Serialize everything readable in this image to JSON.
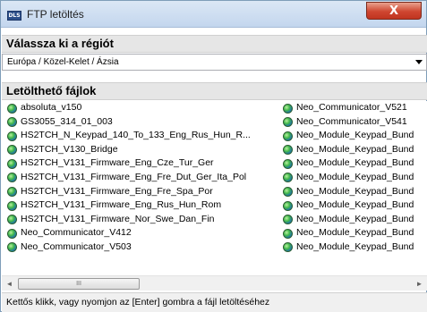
{
  "window": {
    "title": "FTP letöltés",
    "app_icon_text": "DLS",
    "close_glyph": "X"
  },
  "region": {
    "heading": "Válassza ki a régiót",
    "selected": "Európa / Közel-Kelet / Ázsia"
  },
  "files": {
    "heading": "Letölthető fájlok",
    "column1": [
      "absoluta_v150",
      "GS3055_314_01_003",
      "HS2TCH_N_Keypad_140_To_133_Eng_Rus_Hun_R...",
      "HS2TCH_V130_Bridge",
      "HS2TCH_V131_Firmware_Eng_Cze_Tur_Ger",
      "HS2TCH_V131_Firmware_Eng_Fre_Dut_Ger_Ita_Pol",
      "HS2TCH_V131_Firmware_Eng_Fre_Spa_Por",
      "HS2TCH_V131_Firmware_Eng_Rus_Hun_Rom",
      "HS2TCH_V131_Firmware_Nor_Swe_Dan_Fin",
      "Neo_Communicator_V412",
      "Neo_Communicator_V503"
    ],
    "column2": [
      "Neo_Communicator_V521",
      "Neo_Communicator_V541",
      "Neo_Module_Keypad_Bund",
      "Neo_Module_Keypad_Bund",
      "Neo_Module_Keypad_Bund",
      "Neo_Module_Keypad_Bund",
      "Neo_Module_Keypad_Bund",
      "Neo_Module_Keypad_Bund",
      "Neo_Module_Keypad_Bund",
      "Neo_Module_Keypad_Bund",
      "Neo_Module_Keypad_Bund"
    ]
  },
  "scrollbar": {
    "left_glyph": "◄",
    "right_glyph": "►",
    "thumb_grip": "III"
  },
  "status": {
    "text": "Kettős klikk, vagy nyomjon az [Enter] gombra a fájl letöltéséhez"
  },
  "icons": {
    "file_icon": "globe-icon"
  }
}
